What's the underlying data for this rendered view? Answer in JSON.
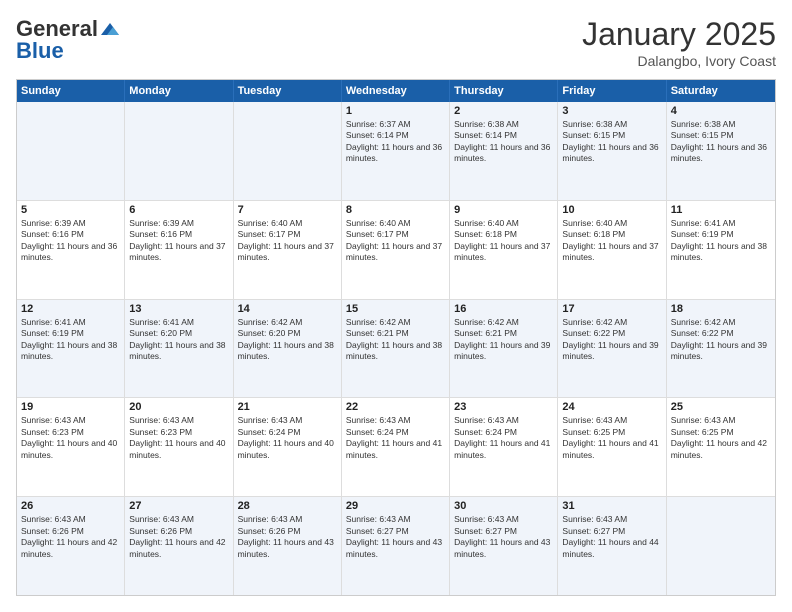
{
  "logo": {
    "general": "General",
    "blue": "Blue"
  },
  "header": {
    "month": "January 2025",
    "location": "Dalangbo, Ivory Coast"
  },
  "weekdays": [
    "Sunday",
    "Monday",
    "Tuesday",
    "Wednesday",
    "Thursday",
    "Friday",
    "Saturday"
  ],
  "rows": [
    [
      {
        "day": "",
        "sunrise": "",
        "sunset": "",
        "daylight": "",
        "empty": true
      },
      {
        "day": "",
        "sunrise": "",
        "sunset": "",
        "daylight": "",
        "empty": true
      },
      {
        "day": "",
        "sunrise": "",
        "sunset": "",
        "daylight": "",
        "empty": true
      },
      {
        "day": "1",
        "sunrise": "Sunrise: 6:37 AM",
        "sunset": "Sunset: 6:14 PM",
        "daylight": "Daylight: 11 hours and 36 minutes."
      },
      {
        "day": "2",
        "sunrise": "Sunrise: 6:38 AM",
        "sunset": "Sunset: 6:14 PM",
        "daylight": "Daylight: 11 hours and 36 minutes."
      },
      {
        "day": "3",
        "sunrise": "Sunrise: 6:38 AM",
        "sunset": "Sunset: 6:15 PM",
        "daylight": "Daylight: 11 hours and 36 minutes."
      },
      {
        "day": "4",
        "sunrise": "Sunrise: 6:38 AM",
        "sunset": "Sunset: 6:15 PM",
        "daylight": "Daylight: 11 hours and 36 minutes."
      }
    ],
    [
      {
        "day": "5",
        "sunrise": "Sunrise: 6:39 AM",
        "sunset": "Sunset: 6:16 PM",
        "daylight": "Daylight: 11 hours and 36 minutes."
      },
      {
        "day": "6",
        "sunrise": "Sunrise: 6:39 AM",
        "sunset": "Sunset: 6:16 PM",
        "daylight": "Daylight: 11 hours and 37 minutes."
      },
      {
        "day": "7",
        "sunrise": "Sunrise: 6:40 AM",
        "sunset": "Sunset: 6:17 PM",
        "daylight": "Daylight: 11 hours and 37 minutes."
      },
      {
        "day": "8",
        "sunrise": "Sunrise: 6:40 AM",
        "sunset": "Sunset: 6:17 PM",
        "daylight": "Daylight: 11 hours and 37 minutes."
      },
      {
        "day": "9",
        "sunrise": "Sunrise: 6:40 AM",
        "sunset": "Sunset: 6:18 PM",
        "daylight": "Daylight: 11 hours and 37 minutes."
      },
      {
        "day": "10",
        "sunrise": "Sunrise: 6:40 AM",
        "sunset": "Sunset: 6:18 PM",
        "daylight": "Daylight: 11 hours and 37 minutes."
      },
      {
        "day": "11",
        "sunrise": "Sunrise: 6:41 AM",
        "sunset": "Sunset: 6:19 PM",
        "daylight": "Daylight: 11 hours and 38 minutes."
      }
    ],
    [
      {
        "day": "12",
        "sunrise": "Sunrise: 6:41 AM",
        "sunset": "Sunset: 6:19 PM",
        "daylight": "Daylight: 11 hours and 38 minutes."
      },
      {
        "day": "13",
        "sunrise": "Sunrise: 6:41 AM",
        "sunset": "Sunset: 6:20 PM",
        "daylight": "Daylight: 11 hours and 38 minutes."
      },
      {
        "day": "14",
        "sunrise": "Sunrise: 6:42 AM",
        "sunset": "Sunset: 6:20 PM",
        "daylight": "Daylight: 11 hours and 38 minutes."
      },
      {
        "day": "15",
        "sunrise": "Sunrise: 6:42 AM",
        "sunset": "Sunset: 6:21 PM",
        "daylight": "Daylight: 11 hours and 38 minutes."
      },
      {
        "day": "16",
        "sunrise": "Sunrise: 6:42 AM",
        "sunset": "Sunset: 6:21 PM",
        "daylight": "Daylight: 11 hours and 39 minutes."
      },
      {
        "day": "17",
        "sunrise": "Sunrise: 6:42 AM",
        "sunset": "Sunset: 6:22 PM",
        "daylight": "Daylight: 11 hours and 39 minutes."
      },
      {
        "day": "18",
        "sunrise": "Sunrise: 6:42 AM",
        "sunset": "Sunset: 6:22 PM",
        "daylight": "Daylight: 11 hours and 39 minutes."
      }
    ],
    [
      {
        "day": "19",
        "sunrise": "Sunrise: 6:43 AM",
        "sunset": "Sunset: 6:23 PM",
        "daylight": "Daylight: 11 hours and 40 minutes."
      },
      {
        "day": "20",
        "sunrise": "Sunrise: 6:43 AM",
        "sunset": "Sunset: 6:23 PM",
        "daylight": "Daylight: 11 hours and 40 minutes."
      },
      {
        "day": "21",
        "sunrise": "Sunrise: 6:43 AM",
        "sunset": "Sunset: 6:24 PM",
        "daylight": "Daylight: 11 hours and 40 minutes."
      },
      {
        "day": "22",
        "sunrise": "Sunrise: 6:43 AM",
        "sunset": "Sunset: 6:24 PM",
        "daylight": "Daylight: 11 hours and 41 minutes."
      },
      {
        "day": "23",
        "sunrise": "Sunrise: 6:43 AM",
        "sunset": "Sunset: 6:24 PM",
        "daylight": "Daylight: 11 hours and 41 minutes."
      },
      {
        "day": "24",
        "sunrise": "Sunrise: 6:43 AM",
        "sunset": "Sunset: 6:25 PM",
        "daylight": "Daylight: 11 hours and 41 minutes."
      },
      {
        "day": "25",
        "sunrise": "Sunrise: 6:43 AM",
        "sunset": "Sunset: 6:25 PM",
        "daylight": "Daylight: 11 hours and 42 minutes."
      }
    ],
    [
      {
        "day": "26",
        "sunrise": "Sunrise: 6:43 AM",
        "sunset": "Sunset: 6:26 PM",
        "daylight": "Daylight: 11 hours and 42 minutes."
      },
      {
        "day": "27",
        "sunrise": "Sunrise: 6:43 AM",
        "sunset": "Sunset: 6:26 PM",
        "daylight": "Daylight: 11 hours and 42 minutes."
      },
      {
        "day": "28",
        "sunrise": "Sunrise: 6:43 AM",
        "sunset": "Sunset: 6:26 PM",
        "daylight": "Daylight: 11 hours and 43 minutes."
      },
      {
        "day": "29",
        "sunrise": "Sunrise: 6:43 AM",
        "sunset": "Sunset: 6:27 PM",
        "daylight": "Daylight: 11 hours and 43 minutes."
      },
      {
        "day": "30",
        "sunrise": "Sunrise: 6:43 AM",
        "sunset": "Sunset: 6:27 PM",
        "daylight": "Daylight: 11 hours and 43 minutes."
      },
      {
        "day": "31",
        "sunrise": "Sunrise: 6:43 AM",
        "sunset": "Sunset: 6:27 PM",
        "daylight": "Daylight: 11 hours and 44 minutes."
      },
      {
        "day": "",
        "sunrise": "",
        "sunset": "",
        "daylight": "",
        "empty": true
      }
    ]
  ],
  "altRows": [
    0,
    2,
    4
  ]
}
